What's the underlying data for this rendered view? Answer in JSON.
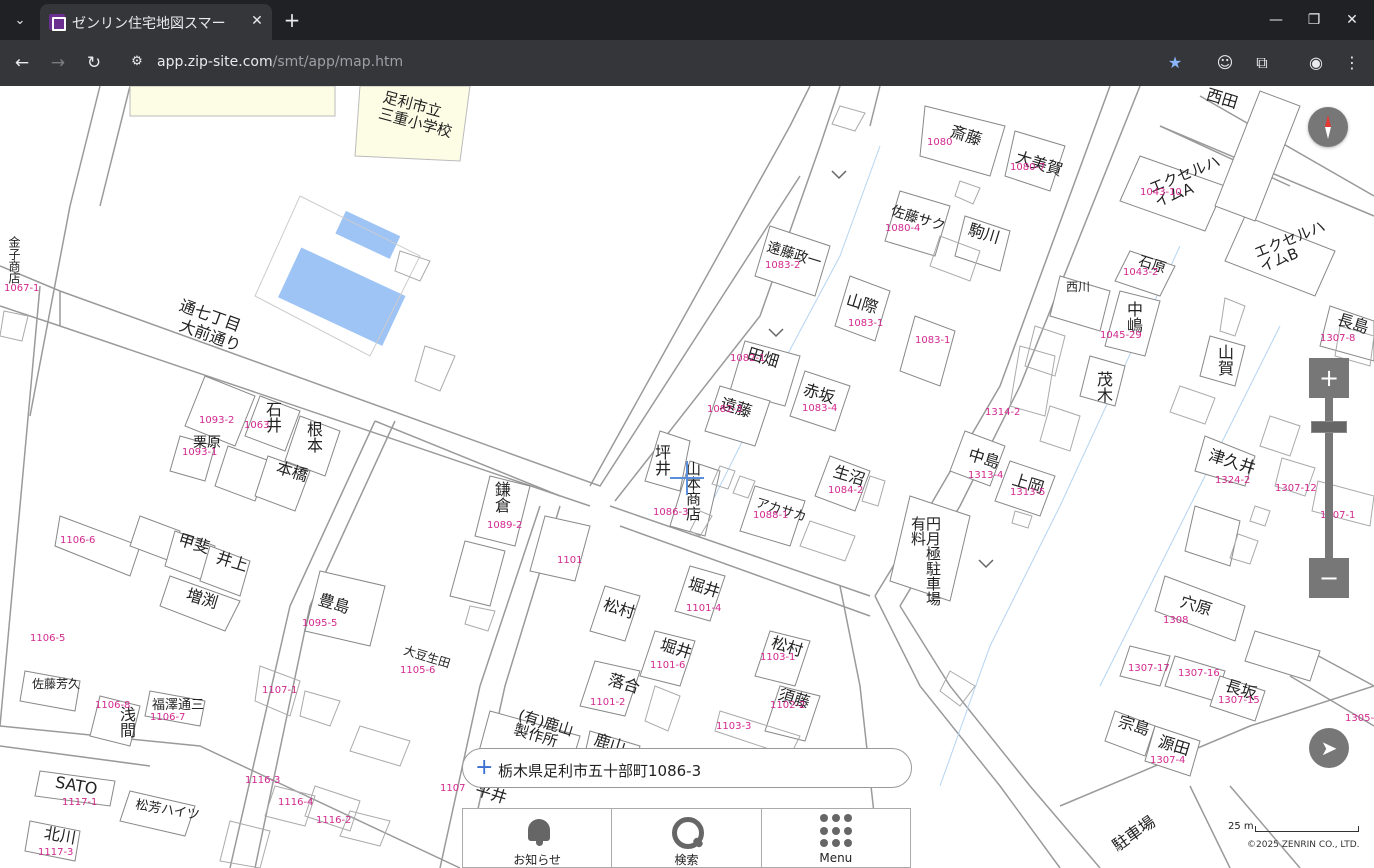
{
  "browser": {
    "tab_title": "ゼンリン住宅地図スマー",
    "url_host": "app.zip-site.com",
    "url_path": "/smt/app/map.htm"
  },
  "map": {
    "school": "足利市立\n三重小学校",
    "labels": [
      "通七丁目",
      "大前通り",
      "斎藤",
      "大美賀",
      "佐藤サク",
      "駒川",
      "遠藤政一",
      "山際",
      "田畑",
      "赤坂",
      "遠藤",
      "坪井",
      "山本商店",
      "生沼",
      "アカサカ",
      "鎌倉",
      "豊島",
      "松村",
      "堀井",
      "堀井",
      "落合",
      "松村",
      "須藤",
      "石井",
      "根本",
      "栗原",
      "本橋",
      "甲斐",
      "井上",
      "増渕",
      "佐藤芳久",
      "浅間",
      "福澤通三",
      "SATO",
      "北川",
      "松芳ハイツ",
      "エクセルハイムA",
      "エクセルハイムB",
      "石原",
      "西川",
      "中嶋",
      "茂木",
      "長島",
      "山賀",
      "中島",
      "上岡",
      "津久井",
      "穴原",
      "宗島",
      "源田",
      "長坂",
      "金子商店",
      "平井",
      "西田",
      "(有)鹿山製作所",
      "鹿山",
      "駐車場",
      "円月極駐車場有料",
      "大豆生田"
    ],
    "parcel_numbers": [
      "1080",
      "1080-7",
      "1080-4",
      "1083-2",
      "1083-1",
      "1082-1",
      "1082-3",
      "1083-4",
      "1086-3",
      "1084-2",
      "1088-1",
      "1089-2",
      "1095-5",
      "1101",
      "1101-4",
      "1101-6",
      "1101-2",
      "1103-1",
      "1102-2",
      "1103-3",
      "1093-2",
      "1063",
      "1093-1",
      "1106-6",
      "1106-5",
      "1106-7",
      "1107-1",
      "1106-8",
      "1117-1",
      "1117-3",
      "1116-3",
      "1116-4",
      "1116-2",
      "1043-10",
      "1043-2",
      "1045-29",
      "1314-2",
      "1313-4",
      "1313-5",
      "1324-2",
      "1307-8",
      "1307-12",
      "1307-1",
      "1308",
      "1307-17",
      "1307-16",
      "1307-15",
      "1307-4",
      "1305-6",
      "1105-6",
      "1067-1",
      "1107",
      "1083-1"
    ],
    "scale_label": "25 m",
    "copyright": "©2025 ZENRIN CO., LTD."
  },
  "controls": {
    "zoom_in": "+",
    "zoom_out": "−",
    "zoom_level": 0.82
  },
  "address": {
    "plus": "+",
    "text": "栃木県足利市五十部町1086-3"
  },
  "menu": {
    "items": [
      {
        "label": "お知らせ",
        "icon": "bell-icon"
      },
      {
        "label": "検索",
        "icon": "search-icon"
      },
      {
        "label": "Menu",
        "icon": "grid-menu-icon"
      }
    ]
  }
}
